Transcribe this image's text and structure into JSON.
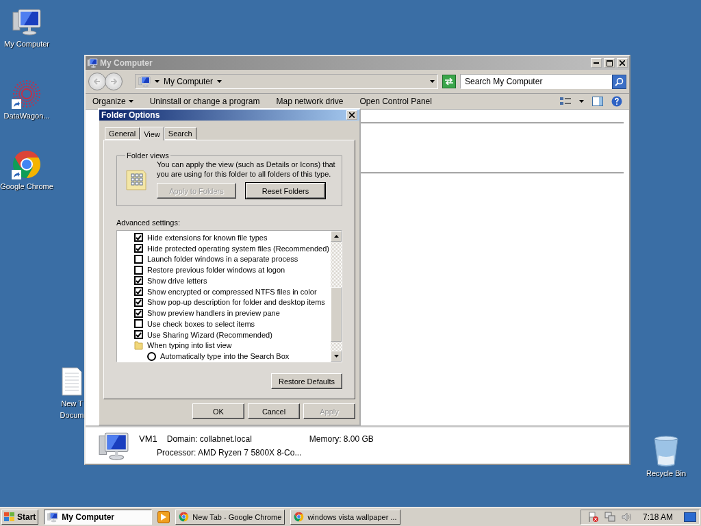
{
  "desktop_icons": [
    {
      "kind": "computer",
      "label": "My Computer"
    },
    {
      "kind": "datawagon",
      "label": "DataWagon..."
    },
    {
      "kind": "chrome",
      "label": "Google Chrome"
    },
    {
      "kind": "document",
      "label": "New T",
      "label_2": "Docum"
    },
    {
      "kind": "recycle",
      "label": "Recycle Bin"
    }
  ],
  "explorer": {
    "title": "My Computer",
    "address": "My Computer",
    "search": {
      "placeholder": "Search My Computer"
    },
    "commands": [
      "Organize",
      "Uninstall or change a program",
      "Map network drive",
      "Open Control Panel"
    ],
    "details": {
      "name": "VM1",
      "domain": "Domain: collabnet.local",
      "memory": "Memory: 8.00 GB",
      "processor": "Processor: AMD Ryzen 7 5800X 8-Co..."
    }
  },
  "dialog": {
    "title": "Folder Options",
    "tabs": [
      {
        "label": "General",
        "selected": false
      },
      {
        "label": "View",
        "selected": true
      },
      {
        "label": "Search",
        "selected": false
      }
    ],
    "folder_views": {
      "legend": "Folder views",
      "description": "You can apply the view (such as Details or Icons) that you are using for this folder to all folders of this type.",
      "buttons": [
        {
          "label": "Apply to Folders",
          "disabled": true
        },
        {
          "label": "Reset Folders",
          "disabled": false
        }
      ]
    },
    "advanced_label": "Advanced settings:",
    "advanced_settings": [
      {
        "kind": "checkbox",
        "label": "Hide extensions for known file types",
        "checked": true
      },
      {
        "kind": "checkbox",
        "label": "Hide protected operating system files (Recommended)",
        "checked": true
      },
      {
        "kind": "checkbox",
        "label": "Launch folder windows in a separate process",
        "checked": false
      },
      {
        "kind": "checkbox",
        "label": "Restore previous folder windows at logon",
        "checked": false
      },
      {
        "kind": "checkbox",
        "label": "Show drive letters",
        "checked": true
      },
      {
        "kind": "checkbox",
        "label": "Show encrypted or compressed NTFS files in color",
        "checked": true
      },
      {
        "kind": "checkbox",
        "label": "Show pop-up description for folder and desktop items",
        "checked": true
      },
      {
        "kind": "checkbox",
        "label": "Show preview handlers in preview pane",
        "checked": true
      },
      {
        "kind": "checkbox",
        "label": "Use check boxes to select items",
        "checked": false
      },
      {
        "kind": "checkbox",
        "label": "Use Sharing Wizard (Recommended)",
        "checked": true
      },
      {
        "kind": "folder",
        "label": "When typing into list view"
      },
      {
        "kind": "radio",
        "label": "Automatically type into the Search Box",
        "selected": false
      }
    ],
    "restore_button": "Restore Defaults",
    "footer_buttons": [
      {
        "label": "OK",
        "disabled": false
      },
      {
        "label": "Cancel",
        "disabled": false
      },
      {
        "label": "Apply",
        "disabled": true
      }
    ]
  },
  "taskbar": {
    "start": "Start",
    "tasks": [
      {
        "label": "My Computer",
        "selected": true
      },
      {
        "label": "New Tab - Google Chrome",
        "selected": false
      },
      {
        "label": "windows vista wallpaper ...",
        "selected": false
      }
    ],
    "clock": "7:18 AM"
  }
}
